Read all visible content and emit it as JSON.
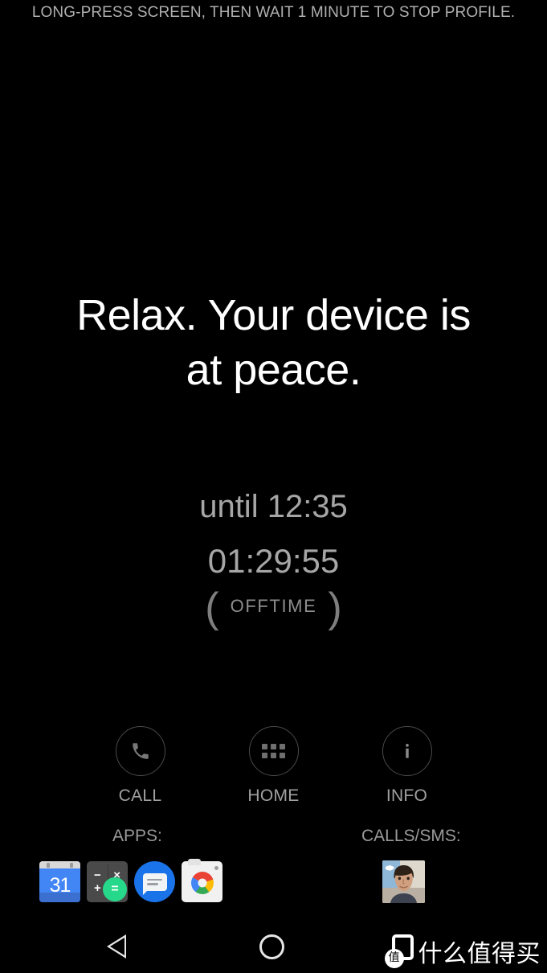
{
  "banner": {
    "text": "LONG-PRESS SCREEN, THEN WAIT 1 MINUTE TO STOP PROFILE."
  },
  "headline": {
    "line1": "Relax. Your device is",
    "line2": "at peace."
  },
  "timer": {
    "until": "until 12:35",
    "countdown": "01:29:55",
    "paren_open": "(",
    "paren_close": ")",
    "profile_name": "OFFTIME"
  },
  "actions": [
    {
      "label": "CALL",
      "icon": "phone-icon"
    },
    {
      "label": "HOME",
      "icon": "apps-grid-icon"
    },
    {
      "label": "INFO",
      "icon": "info-icon"
    }
  ],
  "sections": {
    "apps_label": "APPS:",
    "calls_label": "CALLS/SMS:"
  },
  "apps": [
    {
      "name": "calendar",
      "day": "31"
    },
    {
      "name": "calculator",
      "minus": "−",
      "times": "×",
      "plus": "+",
      "equals": "="
    },
    {
      "name": "messages"
    },
    {
      "name": "camera"
    }
  ],
  "contacts": [
    {
      "name": "contact-avatar"
    }
  ],
  "navbar": {
    "back": "back-button",
    "home": "home-button"
  },
  "watermark": {
    "badge": "值",
    "text": "什么值得买"
  },
  "colors": {
    "background": "#000000",
    "headline": "#ffffff",
    "muted": "#a6a6a6",
    "dim": "#8d8d8d",
    "accent_green": "#26d98a",
    "accent_blue": "#1a73e8"
  }
}
